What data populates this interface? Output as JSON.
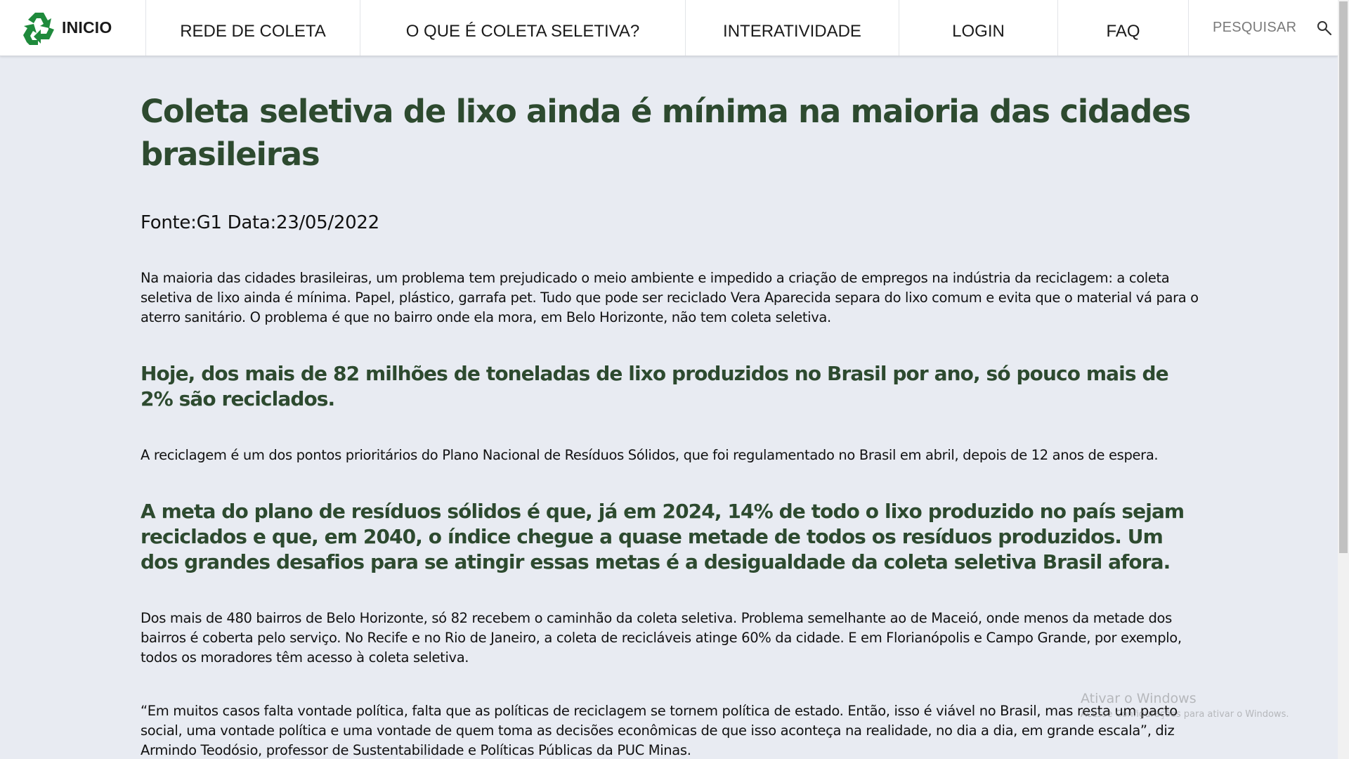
{
  "nav": {
    "brand": "INICIO",
    "items": [
      {
        "label": "REDE DE COLETA"
      },
      {
        "label": "O QUE É COLETA SELETIVA?"
      },
      {
        "label": "INTERATIVIDADE"
      },
      {
        "label": "LOGIN"
      },
      {
        "label": "FAQ"
      }
    ],
    "search_label": "PESQUISAR"
  },
  "article": {
    "title": "Coleta seletiva de lixo ainda é mínima na maioria das cidades brasileiras",
    "source": "Fonte:G1 Data:23/05/2022",
    "p1": "Na maioria das cidades brasileiras, um problema tem prejudicado o meio ambiente e impedido a criação de empregos na indústria da reciclagem: a coleta seletiva de lixo ainda é mínima. Papel, plástico, garrafa pet. Tudo que pode ser reciclado Vera Aparecida separa do lixo comum e evita que o material vá para o aterro sanitário. O problema é que no bairro onde ela mora, em Belo Horizonte, não tem coleta seletiva.",
    "h1": "Hoje, dos mais de 82 milhões de toneladas de lixo produzidos no Brasil por ano, só pouco mais de 2% são reciclados.",
    "p2": "A reciclagem é um dos pontos prioritários do Plano Nacional de Resíduos Sólidos, que foi regulamentado no Brasil em abril, depois de 12 anos de espera.",
    "h2": "A meta do plano de resíduos sólidos é que, já em 2024, 14% de todo o lixo produzido no país sejam reciclados e que, em 2040, o índice chegue a quase metade de todos os resíduos produzidos. Um dos grandes desafios para se atingir essas metas é a desigualdade da coleta seletiva Brasil afora.",
    "p3": "Dos mais de 480 bairros de Belo Horizonte, só 82 recebem o caminhão da coleta seletiva. Problema semelhante ao de Maceió, onde menos da metade dos bairros é coberta pelo serviço. No Recife e no Rio de Janeiro, a coleta de recicláveis atinge 60% da cidade. E em Florianópolis e Campo Grande, por exemplo, todos os moradores têm acesso à coleta seletiva.",
    "p4": "“Em muitos casos falta vontade política, falta que as políticas de reciclagem se tornem política de estado. Então, isso é viável no Brasil, mas resta um pacto social, uma vontade política e uma vontade de quem toma as decisões econômicas de que isso aconteça na realidade, no dia a dia, em grande escala”, diz Armindo Teodósio, professor de Sustentabilidade e Políticas Públicas da PUC Minas."
  },
  "watermark": {
    "title": "Ativar o Windows",
    "subtitle": "Acesse Configurações para ativar o Windows."
  },
  "colors": {
    "heading": "#2d4a2f",
    "logo_green": "#1f8a3c",
    "background": "#e8ebf2"
  },
  "icons": {
    "logo": "recycle-icon",
    "search": "search-icon"
  }
}
